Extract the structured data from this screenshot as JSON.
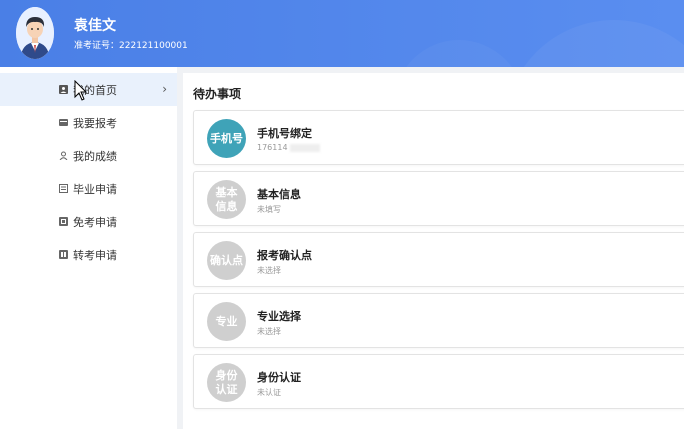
{
  "header": {
    "user_name": "袁佳文",
    "id_label": "准考证号：",
    "id_value": "222121100001"
  },
  "sidebar": {
    "items": [
      {
        "label": "我的首页",
        "icon": "profile-card-icon",
        "active": true
      },
      {
        "label": "我要报考",
        "icon": "card-icon"
      },
      {
        "label": "我的成绩",
        "icon": "person-icon"
      },
      {
        "label": "毕业申请",
        "icon": "document-icon"
      },
      {
        "label": "免考申请",
        "icon": "exempt-icon"
      },
      {
        "label": "转考申请",
        "icon": "transfer-icon"
      }
    ]
  },
  "main": {
    "title": "待办事项",
    "todos": [
      {
        "badge": "手机号",
        "title": "手机号绑定",
        "subtitle": "176114",
        "badge_color": "#3fa3b8"
      },
      {
        "badge": "基本\n信息",
        "title": "基本信息",
        "subtitle": "未填写",
        "badge_color": "#cfcfcf"
      },
      {
        "badge": "确认点",
        "title": "报考确认点",
        "subtitle": "未选择",
        "badge_color": "#cfcfcf"
      },
      {
        "badge": "专业",
        "title": "专业选择",
        "subtitle": "未选择",
        "badge_color": "#cfcfcf"
      },
      {
        "badge": "身份\n认证",
        "title": "身份认证",
        "subtitle": "未认证",
        "badge_color": "#cfcfcf"
      }
    ]
  },
  "colors": {
    "header": "#4a7fe6",
    "active_nav": "#e9f1fc",
    "teal_badge": "#3fa3b8",
    "grey_badge": "#cfcfcf"
  }
}
